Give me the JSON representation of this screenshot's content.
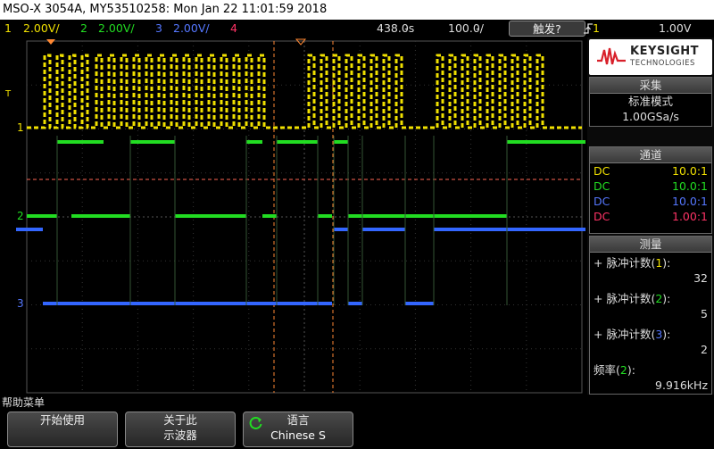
{
  "title": "MSO-X 3054A, MY53510258: Mon Jan 22 11:01:59 2018",
  "status": {
    "ch1_num": "1",
    "ch1_scale": "2.00V/",
    "ch2_num": "2",
    "ch2_scale": "2.00V/",
    "ch3_num": "3",
    "ch3_scale": "2.00V/",
    "ch4_num": "4",
    "delay": "438.0̵s",
    "timebase": "100.0̵/",
    "trigger_button": "触发?",
    "trigger_source": "1",
    "trigger_level": "1.00V"
  },
  "markers": {
    "trig": "T",
    "ch1": "1",
    "ch2": "2",
    "ch3": "3"
  },
  "logo": {
    "brand": "KEYSIGHT",
    "sub": "TECHNOLOGIES"
  },
  "acquisition": {
    "header": "采集",
    "mode": "标准模式",
    "rate": "1.00GSa/s"
  },
  "channels": {
    "header": "通道",
    "rows": [
      {
        "coupling": "DC",
        "probe": "10.0:1"
      },
      {
        "coupling": "DC",
        "probe": "10.0:1"
      },
      {
        "coupling": "DC",
        "probe": "10.0:1"
      },
      {
        "coupling": "DC",
        "probe": "1.00:1"
      }
    ]
  },
  "measure": {
    "header": "测量",
    "items": [
      {
        "label": "+ 脉冲计数",
        "ch": "1",
        "value": "32"
      },
      {
        "label": "+ 脉冲计数",
        "ch": "2",
        "value": "5"
      },
      {
        "label": "+ 脉冲计数",
        "ch": "3",
        "value": "2"
      }
    ],
    "freq_label": "频率",
    "freq_ch": "2",
    "freq_value": "9.916kHz"
  },
  "menu": {
    "title": "帮助菜单",
    "key1_line1": "开始使用",
    "key2_line1": "关于此",
    "key2_line2": "示波器",
    "key3_line1": "语言",
    "key3_line2": "Chinese S"
  },
  "colors": {
    "ch1": "#f0e000",
    "ch2": "#22dd22",
    "ch3": "#3366ff",
    "ch4": "#ff3366"
  }
}
